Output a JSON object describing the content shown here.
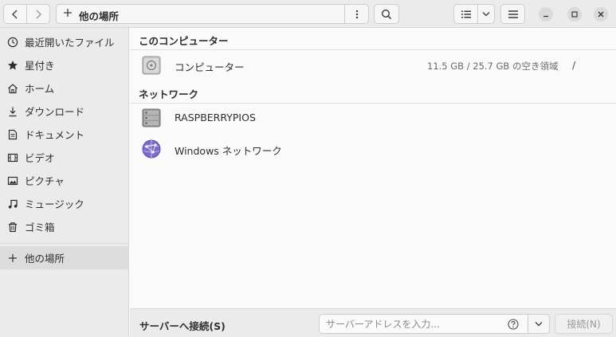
{
  "header": {
    "path_label": "他の場所",
    "path_icon": "plus-icon"
  },
  "sidebar": {
    "items": [
      {
        "label": "最近開いたファイル",
        "icon": "clock-icon"
      },
      {
        "label": "星付き",
        "icon": "star-icon"
      },
      {
        "label": "ホーム",
        "icon": "home-icon"
      },
      {
        "label": "ダウンロード",
        "icon": "download-icon"
      },
      {
        "label": "ドキュメント",
        "icon": "document-icon"
      },
      {
        "label": "ビデオ",
        "icon": "video-icon"
      },
      {
        "label": "ピクチャ",
        "icon": "picture-icon"
      },
      {
        "label": "ミュージック",
        "icon": "music-icon"
      },
      {
        "label": "ゴミ箱",
        "icon": "trash-icon"
      },
      {
        "label": "他の場所",
        "icon": "plus-icon",
        "active": true
      }
    ]
  },
  "main": {
    "computer_section": {
      "heading": "このコンピューター",
      "rows": [
        {
          "label": "コンピューター",
          "info": "11.5 GB / 25.7 GB の空き領域",
          "mount": "/"
        }
      ]
    },
    "network_section": {
      "heading": "ネットワーク",
      "rows": [
        {
          "label": "RASPBERRYPIOS"
        },
        {
          "label": "Windows ネットワーク"
        }
      ]
    }
  },
  "bottom": {
    "connect_label": "サーバーへ接続(S)",
    "server_placeholder": "サーバーアドレスを入力...",
    "connect_button": "接続(N)"
  },
  "colors": {
    "sidebar_bg": "#ebebeb",
    "active_bg": "#dcdcdc",
    "content_bg": "#fafafa",
    "network_globe": "#7b6bc9"
  }
}
